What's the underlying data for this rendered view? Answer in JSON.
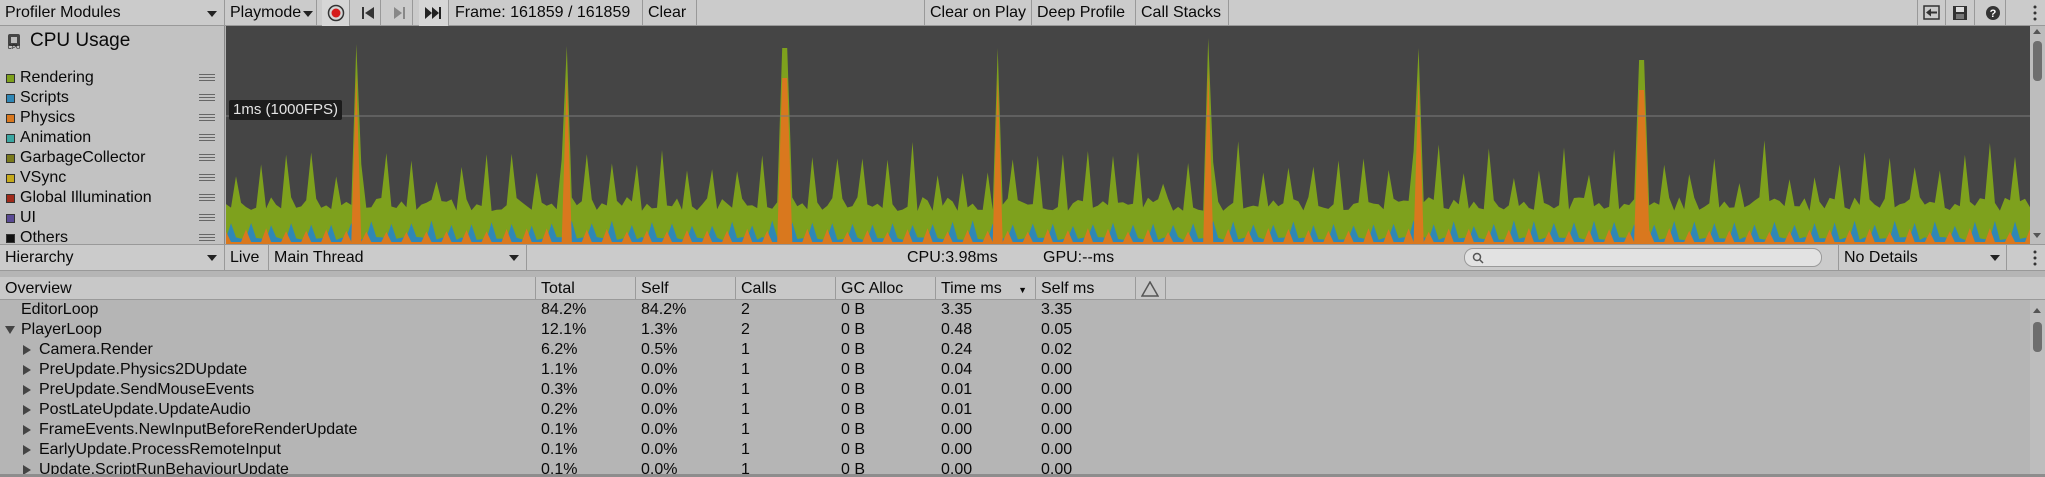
{
  "toolbar": {
    "profiler_modules": "Profiler Modules",
    "playmode": "Playmode",
    "frame": "Frame: 161859 / 161859",
    "clear": "Clear",
    "clear_on_play": "Clear on Play",
    "deep_profile": "Deep Profile",
    "call_stacks": "Call Stacks"
  },
  "module": {
    "title": "CPU Usage",
    "legend": [
      {
        "label": "Rendering",
        "color": "#7ea11d"
      },
      {
        "label": "Scripts",
        "color": "#2f87b5"
      },
      {
        "label": "Physics",
        "color": "#d9781e"
      },
      {
        "label": "Animation",
        "color": "#3aa6a1"
      },
      {
        "label": "GarbageCollector",
        "color": "#7a7a1c"
      },
      {
        "label": "VSync",
        "color": "#c5a91b"
      },
      {
        "label": "Global Illumination",
        "color": "#a02a1a"
      },
      {
        "label": "UI",
        "color": "#5a4a94"
      },
      {
        "label": "Others",
        "color": "#111111"
      }
    ]
  },
  "chart": {
    "threshold_label": "1ms (1000FPS)"
  },
  "details_bar": {
    "hierarchy": "Hierarchy",
    "live": "Live",
    "thread": "Main Thread",
    "cpu": "CPU:3.98ms",
    "gpu": "GPU:--ms",
    "details": "No Details"
  },
  "table": {
    "columns": [
      "Overview",
      "Total",
      "Self",
      "Calls",
      "GC Alloc",
      "Time ms",
      "Self ms"
    ],
    "rows": [
      {
        "name": "EditorLoop",
        "indent": 0,
        "arrow": "none",
        "total": "84.2%",
        "self": "84.2%",
        "calls": "2",
        "gc": "0 B",
        "time": "3.35",
        "selfms": "3.35"
      },
      {
        "name": "PlayerLoop",
        "indent": 0,
        "arrow": "down",
        "total": "12.1%",
        "self": "1.3%",
        "calls": "2",
        "gc": "0 B",
        "time": "0.48",
        "selfms": "0.05"
      },
      {
        "name": "Camera.Render",
        "indent": 1,
        "arrow": "right",
        "total": "6.2%",
        "self": "0.5%",
        "calls": "1",
        "gc": "0 B",
        "time": "0.24",
        "selfms": "0.02"
      },
      {
        "name": "PreUpdate.Physics2DUpdate",
        "indent": 1,
        "arrow": "right",
        "total": "1.1%",
        "self": "0.0%",
        "calls": "1",
        "gc": "0 B",
        "time": "0.04",
        "selfms": "0.00"
      },
      {
        "name": "PreUpdate.SendMouseEvents",
        "indent": 1,
        "arrow": "right",
        "total": "0.3%",
        "self": "0.0%",
        "calls": "1",
        "gc": "0 B",
        "time": "0.01",
        "selfms": "0.00"
      },
      {
        "name": "PostLateUpdate.UpdateAudio",
        "indent": 1,
        "arrow": "right",
        "total": "0.2%",
        "self": "0.0%",
        "calls": "1",
        "gc": "0 B",
        "time": "0.01",
        "selfms": "0.00"
      },
      {
        "name": "FrameEvents.NewInputBeforeRenderUpdate",
        "indent": 1,
        "arrow": "right",
        "total": "0.1%",
        "self": "0.0%",
        "calls": "1",
        "gc": "0 B",
        "time": "0.00",
        "selfms": "0.00"
      },
      {
        "name": "EarlyUpdate.ProcessRemoteInput",
        "indent": 1,
        "arrow": "right",
        "total": "0.1%",
        "self": "0.0%",
        "calls": "1",
        "gc": "0 B",
        "time": "0.00",
        "selfms": "0.00"
      },
      {
        "name": "Update.ScriptRunBehaviourUpdate",
        "indent": 1,
        "arrow": "right",
        "total": "0.1%",
        "self": "0.0%",
        "calls": "1",
        "gc": "0 B",
        "time": "0.00",
        "selfms": "0.00"
      }
    ]
  }
}
